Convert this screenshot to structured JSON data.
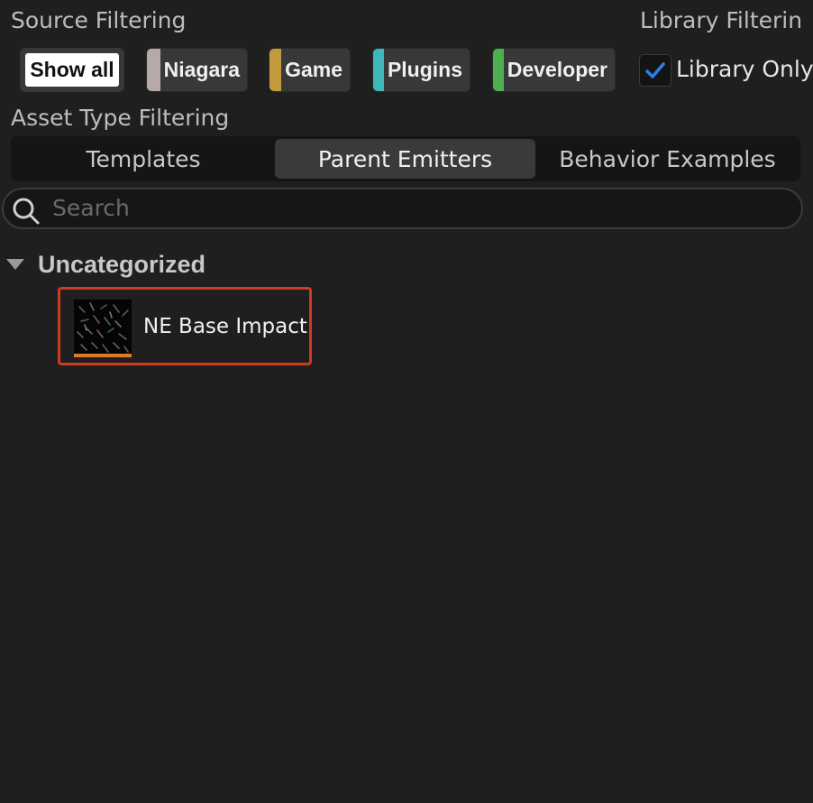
{
  "source_filtering": {
    "title": "Source Filtering",
    "show_all_label": "Show all",
    "chips": [
      {
        "label": "Niagara",
        "color": "#b5aaa8"
      },
      {
        "label": "Game",
        "color": "#c49a3e"
      },
      {
        "label": "Plugins",
        "color": "#3fb6b8"
      },
      {
        "label": "Developer",
        "color": "#4caf50"
      }
    ]
  },
  "library_filtering": {
    "title": "Library Filterin",
    "library_only_label": "Library Only",
    "library_only_checked": true,
    "check_color": "#2d7fe0"
  },
  "asset_type_filtering": {
    "title": "Asset Type Filtering",
    "tabs": [
      {
        "label": "Templates",
        "active": false
      },
      {
        "label": "Parent Emitters",
        "active": true
      },
      {
        "label": "Behavior Examples",
        "active": false
      }
    ]
  },
  "search": {
    "placeholder": "Search",
    "icon": "search-icon"
  },
  "tree": {
    "category_label": "Uncategorized",
    "expanded": true,
    "items": [
      {
        "name": "NE Base Impact",
        "thumbnail_bar_color": "#e0782a",
        "highlighted": true
      }
    ]
  }
}
